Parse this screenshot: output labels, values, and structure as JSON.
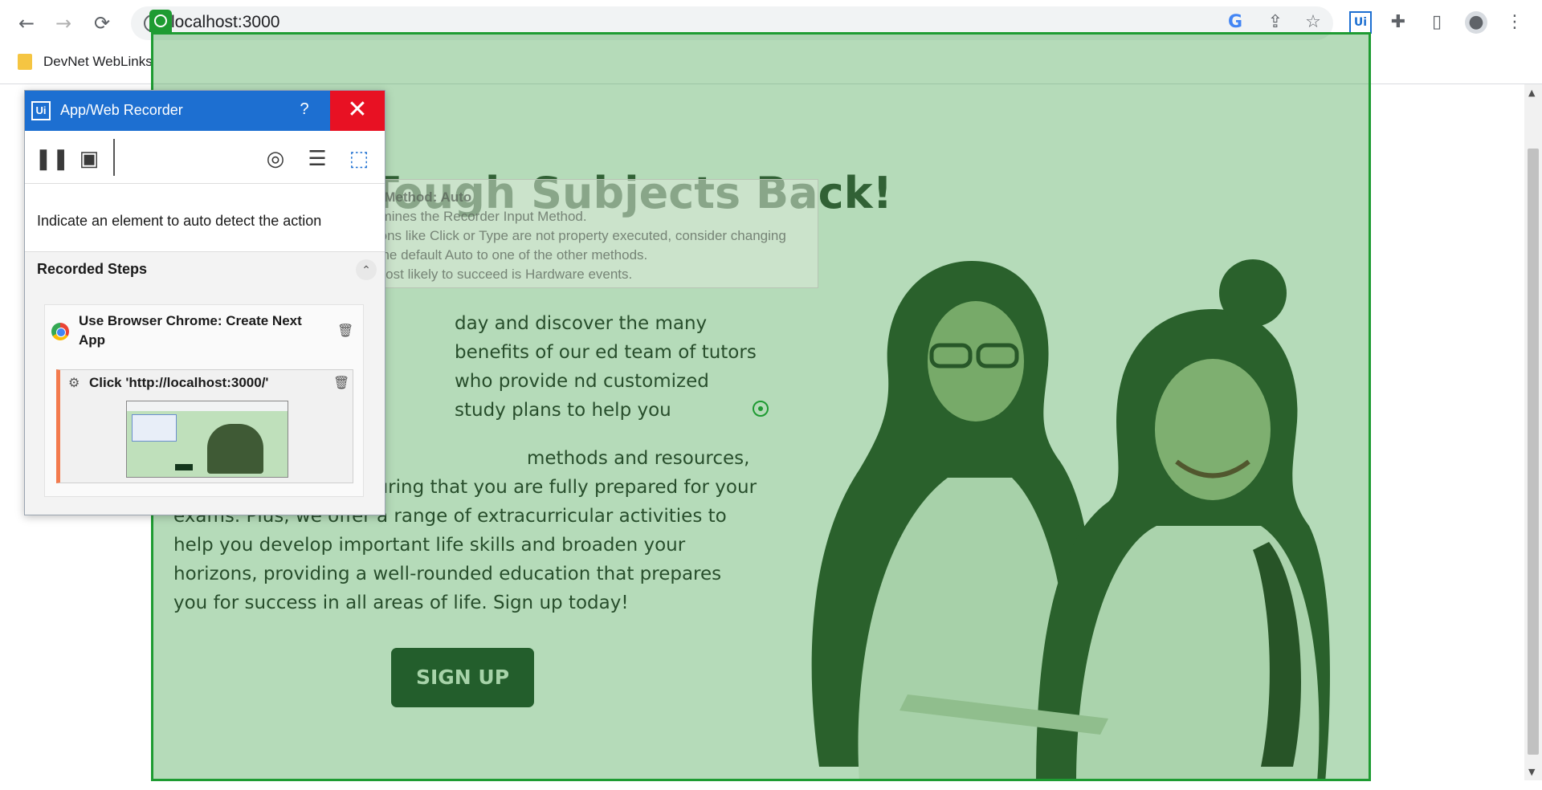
{
  "browser": {
    "url": "localhost:3000",
    "bookmark_label": "DevNet WebLinks",
    "extension_label": "Ui"
  },
  "page": {
    "hero_title": "Tough Subjects Back!",
    "paragraph_1": "day and discover the many benefits of our ed team of tutors who provide nd customized study plans to help you",
    "paragraph_2": "methods and resources, we make learning ensuring that you are fully prepared for your exams. Plus, we offer a range of extracurricular activities to help you develop important life skills and broaden your horizons, providing a well-rounded education that prepares you for success in all areas of life. Sign up today!",
    "signup_label": "SIGN UP"
  },
  "tooltip": {
    "title": "Input Method: Auto",
    "line1": "Determines the Recorder Input Method.",
    "line2": "If actions like Click or Type are not property executed, consider changing",
    "line3": "from the default Auto to one of the other methods.",
    "line4": "The most likely to succeed is Hardware events."
  },
  "recorder": {
    "title": "App/Web Recorder",
    "logo": "Ui",
    "help": "?",
    "message": "Indicate an element to auto detect the action",
    "steps_header": "Recorded Steps",
    "step_label": "Use Browser Chrome: Create Next App",
    "sub_step_label": "Click 'http://localhost:3000/'"
  },
  "colors": {
    "highlight": "#1e9b32",
    "recorder_title_bg": "#1d6fd1",
    "close_bg": "#e81123",
    "signup_bg": "#14361c"
  }
}
